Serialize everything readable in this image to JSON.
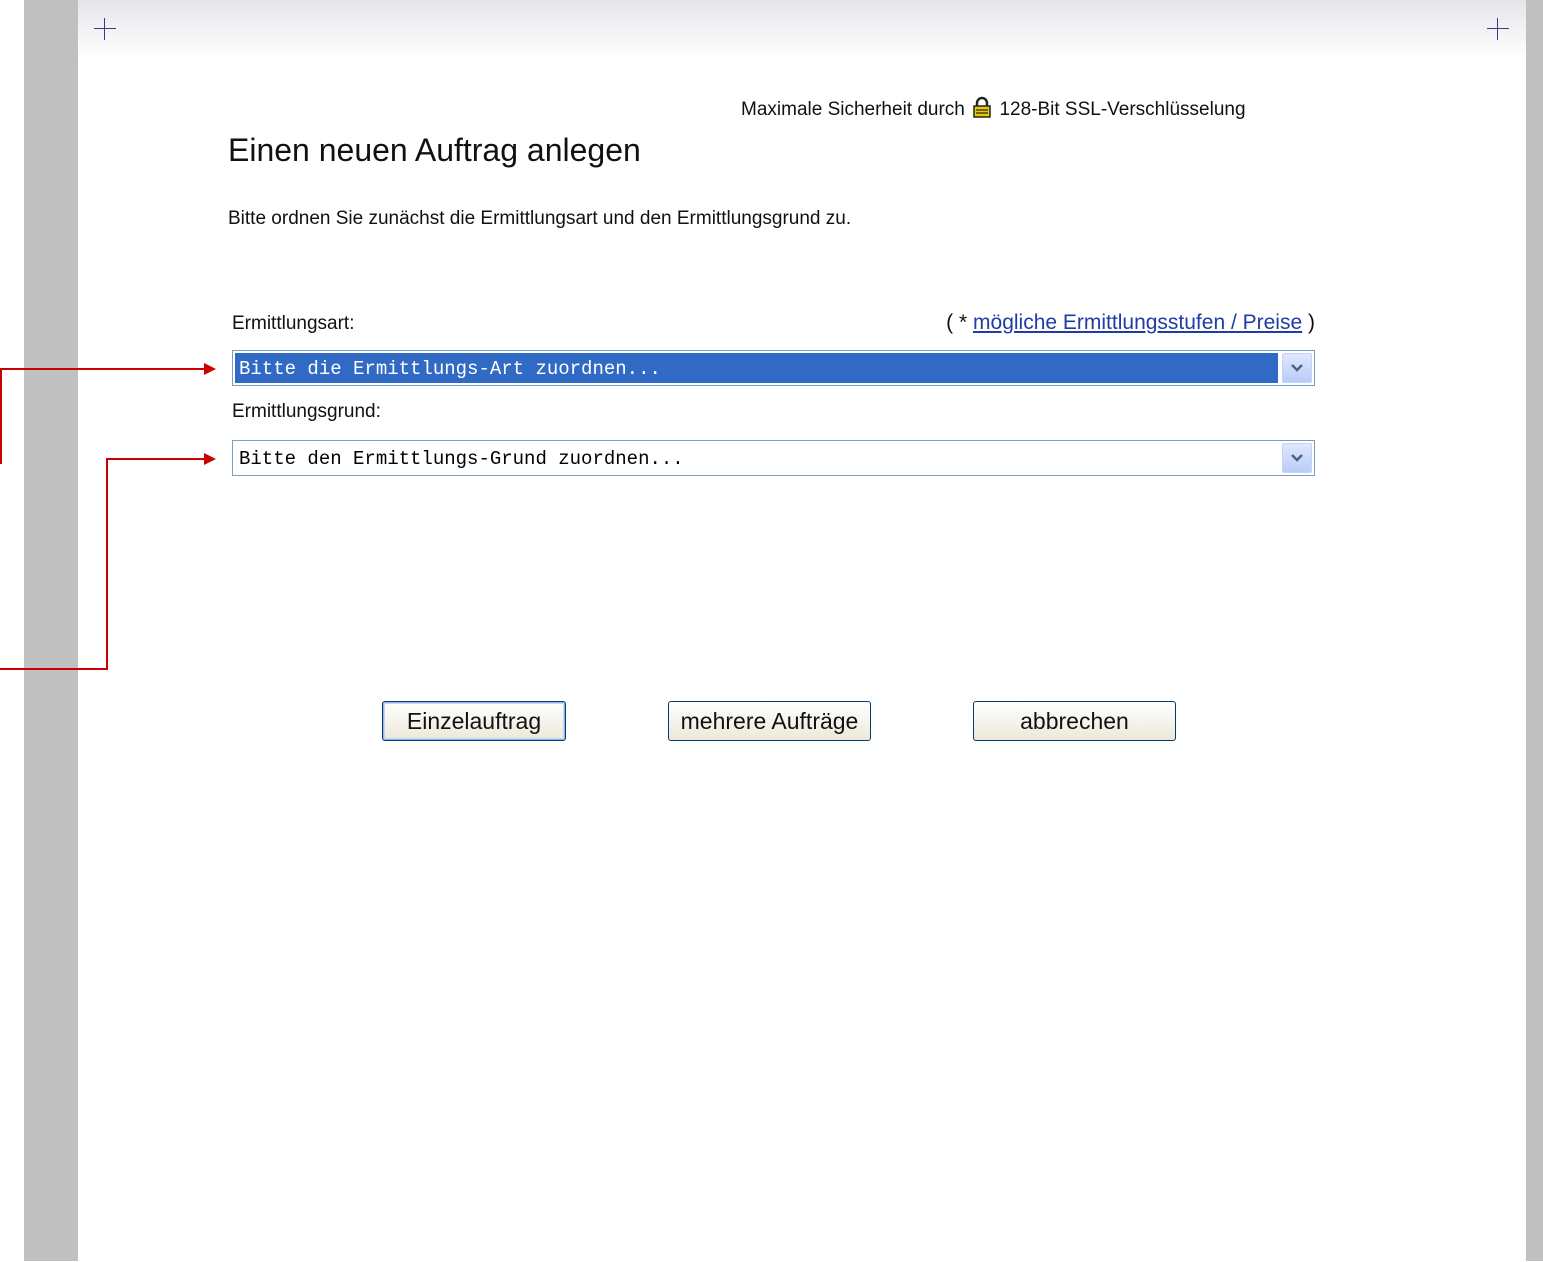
{
  "header": {
    "security_prefix": "Maximale Sicherheit durch",
    "security_suffix": "128-Bit SSL-Verschlüsselung"
  },
  "page": {
    "title": "Einen neuen Auftrag anlegen",
    "intro": "Bitte ordnen Sie zunächst die Ermittlungsart und den Ermittlungsgrund zu."
  },
  "form": {
    "art_label": "Ermittlungsart:",
    "hint_open": "( *",
    "hint_link": "mögliche Ermittlungsstufen / Preise",
    "hint_close": ")",
    "art_select_value": "Bitte die Ermittlungs-Art zuordnen...",
    "grund_label": "Ermittlungsgrund:",
    "grund_select_value": "Bitte den Ermittlungs-Grund zuordnen..."
  },
  "buttons": {
    "single": "Einzelauftrag",
    "multiple": "mehrere Aufträge",
    "cancel": "abbrechen"
  },
  "colors": {
    "selection": "#316ac5",
    "link": "#1f3ca6",
    "callout": "#cc0000"
  }
}
